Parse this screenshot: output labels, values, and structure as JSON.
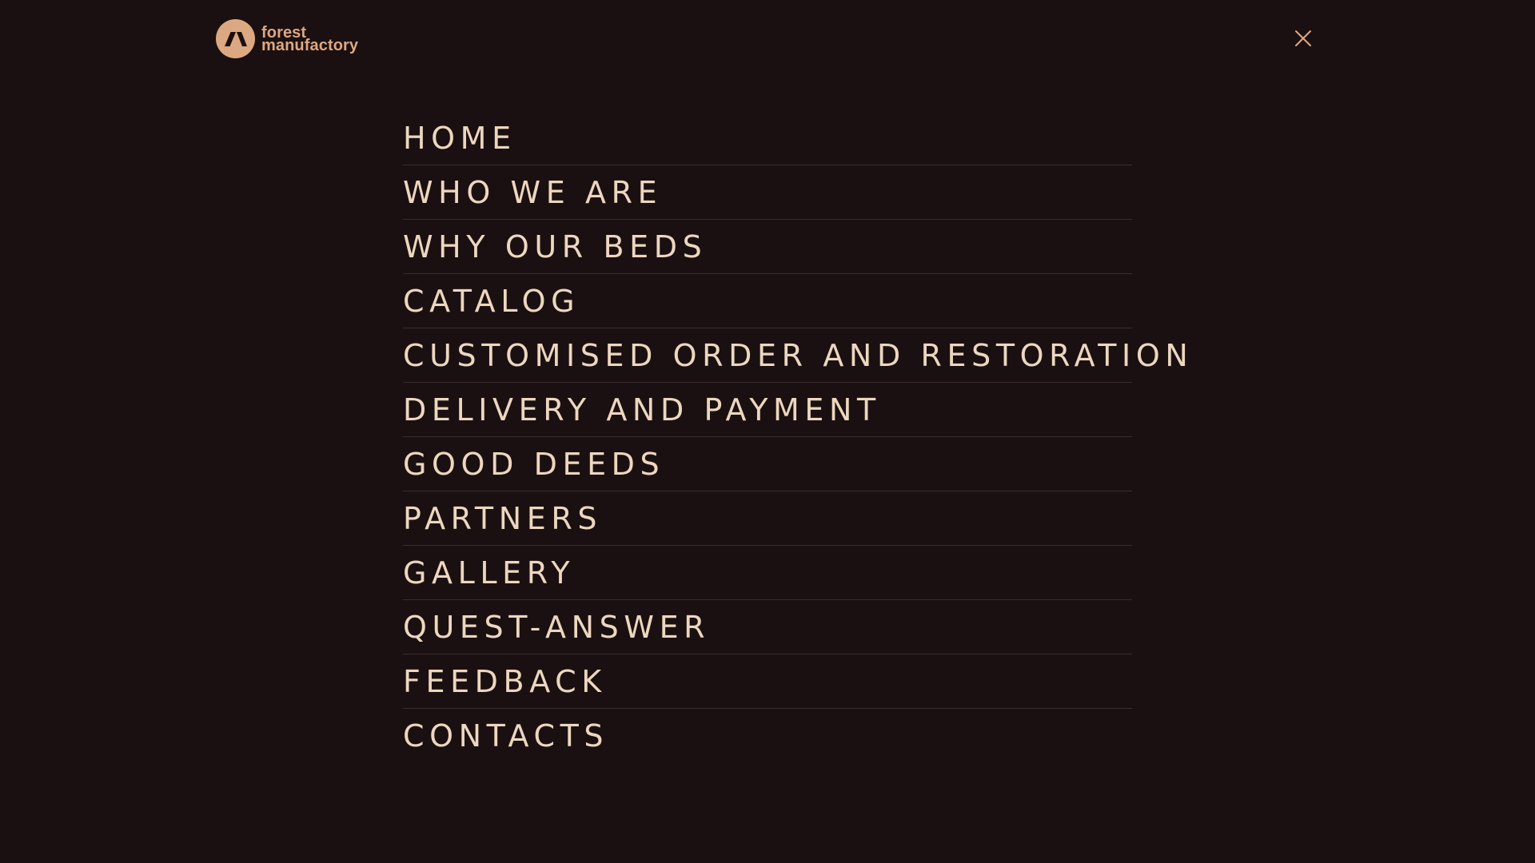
{
  "header": {
    "logo": {
      "line1": "forest",
      "line2": "manufactory",
      "icon": "forest-manufactory-logo-icon",
      "mark_color": "#dca882"
    },
    "close_icon": "close-icon",
    "close_color": "#dca882"
  },
  "menu": {
    "items": [
      {
        "label": "HOME"
      },
      {
        "label": "WHO WE ARE"
      },
      {
        "label": "WHY OUR BEDS"
      },
      {
        "label": "CATALOG"
      },
      {
        "label": "CUSTOMISED ORDER AND RESTORATION"
      },
      {
        "label": "DELIVERY AND PAYMENT"
      },
      {
        "label": "GOOD DEEDS"
      },
      {
        "label": "PARTNERS"
      },
      {
        "label": "GALLERY"
      },
      {
        "label": "QUEST-ANSWER"
      },
      {
        "label": "FEEDBACK"
      },
      {
        "label": "CONTACTS"
      }
    ]
  },
  "colors": {
    "background": "#1b1011",
    "menu_text": "#ecd7bf",
    "divider": "#3a2c2b",
    "accent": "#dca882"
  }
}
